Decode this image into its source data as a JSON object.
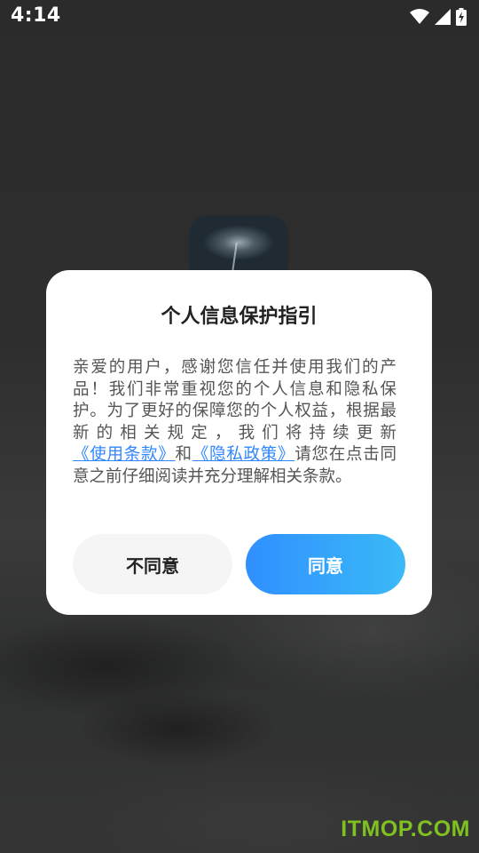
{
  "status_bar": {
    "time": "4:14",
    "icons": [
      "wifi-icon",
      "signal-icon",
      "battery-charging-icon"
    ]
  },
  "app": {
    "icon": "storm-cloud-app-icon"
  },
  "dialog": {
    "title": "个人信息保护指引",
    "body_part1": "亲爱的用户，感谢您信任并使用我们的产品！我们非常重视您的个人信息和隐私保护。为了更好的保障您的个人权益，根据最新的相关规定，我们将持续更新",
    "terms_link": "《使用条款》",
    "and_text": "和",
    "privacy_link": "《隐私政策》",
    "body_part2": "请您在点击同意之前仔细阅读并充分理解相关条款。",
    "disagree_label": "不同意",
    "agree_label": "同意"
  },
  "watermark": "ITMOP.COM",
  "colors": {
    "link": "#2f86ff",
    "agree_gradient_start": "#2f8fff",
    "agree_gradient_end": "#3bbaf7",
    "watermark": "#7fc21f"
  }
}
